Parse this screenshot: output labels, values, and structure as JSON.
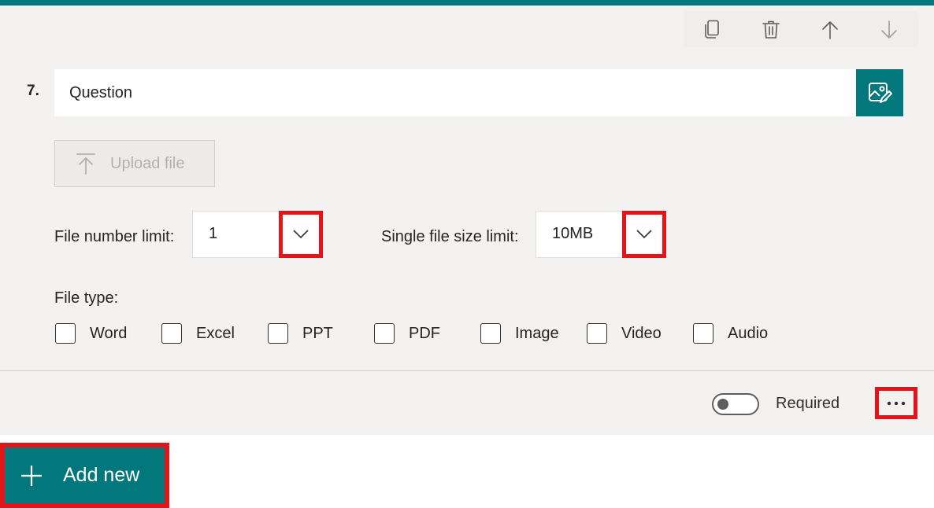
{
  "question": {
    "number": "7.",
    "placeholder": "Question"
  },
  "toolbar": {
    "icons": [
      "copy-icon",
      "delete-icon",
      "move-up-icon",
      "move-down-icon"
    ]
  },
  "upload": {
    "label": "Upload file"
  },
  "limits": {
    "file_number_label": "File number limit:",
    "file_number_value": "1",
    "file_size_label": "Single file size limit:",
    "file_size_value": "10MB"
  },
  "file_type": {
    "label": "File type:",
    "options": [
      "Word",
      "Excel",
      "PPT",
      "PDF",
      "Image",
      "Video",
      "Audio"
    ]
  },
  "footer": {
    "required_label": "Required",
    "required_on": false
  },
  "add_new": {
    "label": "Add new"
  },
  "colors": {
    "accent": "#03787c",
    "highlight": "#e3151b",
    "card_bg": "#f3f2f1"
  }
}
